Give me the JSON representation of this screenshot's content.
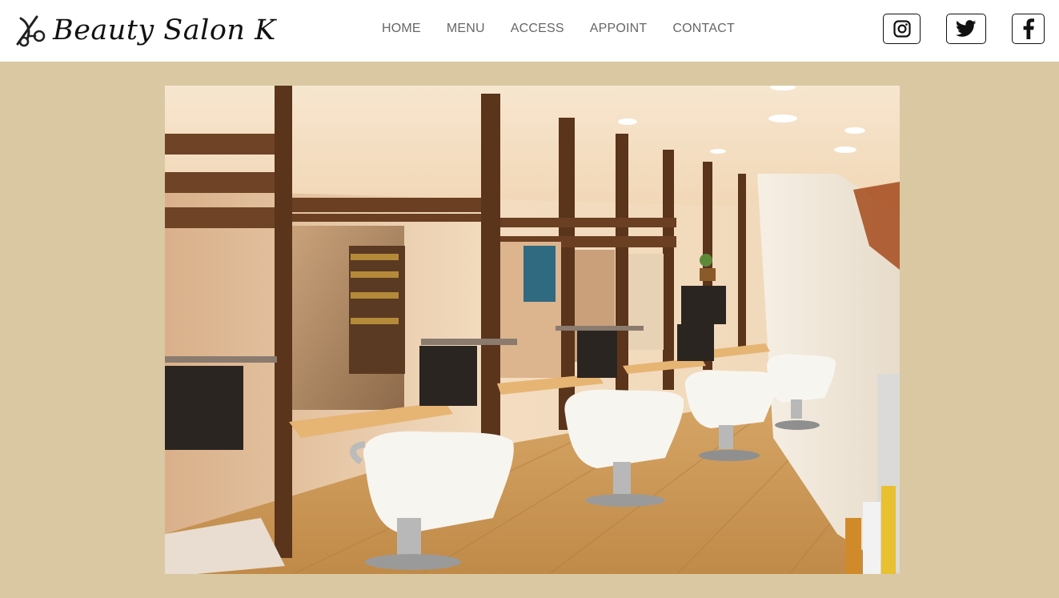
{
  "site": {
    "logo_text": "Beauty Salon K",
    "logo_icon": "scissors-icon"
  },
  "nav": {
    "items": [
      {
        "label": "HOME"
      },
      {
        "label": "MENU"
      },
      {
        "label": "ACCESS"
      },
      {
        "label": "APPOINT"
      },
      {
        "label": "CONTACT"
      }
    ]
  },
  "social": {
    "items": [
      {
        "name": "instagram-icon"
      },
      {
        "name": "twitter-icon"
      },
      {
        "name": "facebook-icon"
      }
    ]
  },
  "colors": {
    "page_background": "#d9c8a2",
    "header_background": "#ffffff",
    "nav_text": "#666666",
    "icon_border": "#111111"
  },
  "hero": {
    "subject": "salon-interior-photo"
  }
}
